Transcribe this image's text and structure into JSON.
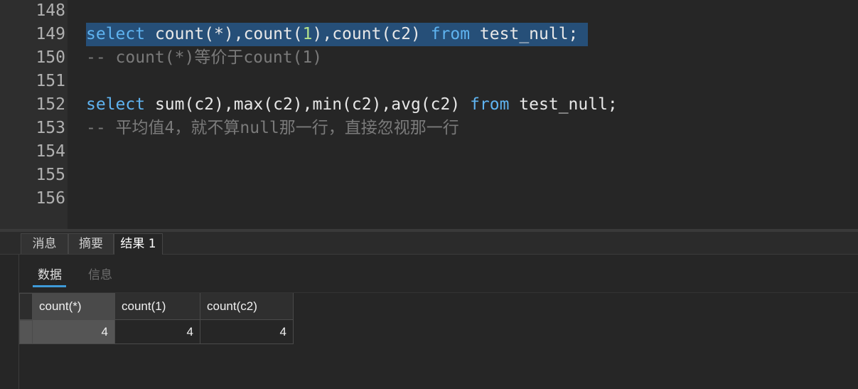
{
  "editor": {
    "lines": [
      {
        "num": "148",
        "parts": []
      },
      {
        "num": "149",
        "parts": [
          {
            "t": "select",
            "c": "kw"
          },
          {
            "t": " count(*),count(",
            "c": ""
          },
          {
            "t": "1",
            "c": "num"
          },
          {
            "t": "),count(c2) ",
            "c": ""
          },
          {
            "t": "from",
            "c": "kw"
          },
          {
            "t": " test_null;",
            "c": ""
          }
        ],
        "highlight": true
      },
      {
        "num": "150",
        "parts": [
          {
            "t": "-- count(*)等价于count(1)",
            "c": "cmt"
          }
        ]
      },
      {
        "num": "151",
        "parts": []
      },
      {
        "num": "152",
        "parts": [
          {
            "t": "select",
            "c": "kw"
          },
          {
            "t": " sum(c2),max(c2),min(c2),avg(c2) ",
            "c": ""
          },
          {
            "t": "from",
            "c": "kw"
          },
          {
            "t": " test_null;",
            "c": ""
          }
        ]
      },
      {
        "num": "153",
        "parts": [
          {
            "t": "-- 平均值4，就不算null那一行，直接忽视那一行",
            "c": "cmt"
          }
        ]
      },
      {
        "num": "154",
        "parts": []
      },
      {
        "num": "155",
        "parts": []
      },
      {
        "num": "156",
        "parts": []
      }
    ]
  },
  "result_tabs": {
    "messages": "消息",
    "summary": "摘要",
    "result1": "结果 1"
  },
  "sub_tabs": {
    "data": "数据",
    "info": "信息"
  },
  "grid": {
    "columns": [
      "count(*)",
      "count(1)",
      "count(c2)"
    ],
    "rows": [
      [
        "4",
        "4",
        "4"
      ]
    ]
  }
}
